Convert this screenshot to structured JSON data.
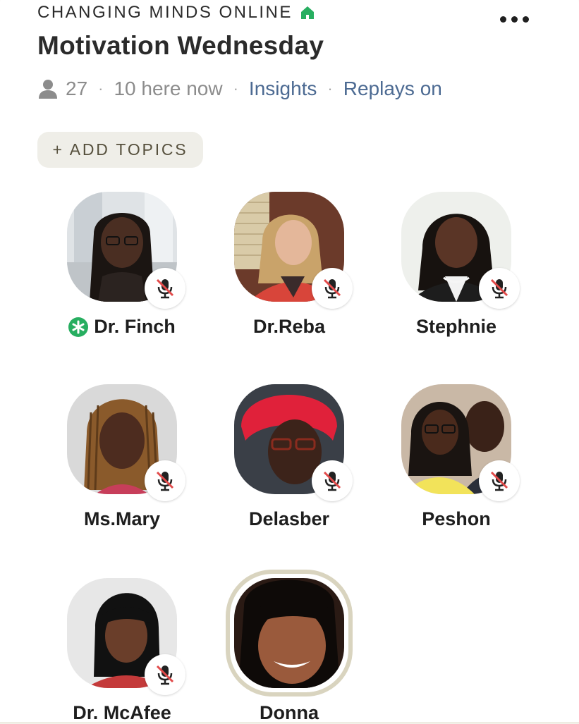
{
  "header": {
    "club_name": "CHANGING MINDS ONLINE",
    "club_icon": "house-icon",
    "more_icon": "ellipsis-icon",
    "room_title": "Motivation Wednesday",
    "listener_icon": "person-icon",
    "listener_count": "27",
    "here_now": "10 here now",
    "insights_label": "Insights",
    "replays_label": "Replays on",
    "separator": "·"
  },
  "topics": {
    "add_label": "+ ADD TOPICS"
  },
  "speakers": [
    {
      "name": "Dr. Finch",
      "moderator": true,
      "muted": true,
      "speaking": false
    },
    {
      "name": "Dr.Reba",
      "moderator": false,
      "muted": true,
      "speaking": false
    },
    {
      "name": "Stephnie",
      "moderator": false,
      "muted": true,
      "speaking": false
    },
    {
      "name": "Ms.Mary",
      "moderator": false,
      "muted": true,
      "speaking": false
    },
    {
      "name": "Delasber",
      "moderator": false,
      "muted": true,
      "speaking": false
    },
    {
      "name": "Peshon",
      "moderator": false,
      "muted": true,
      "speaking": false
    },
    {
      "name": "Dr. McAfee",
      "moderator": false,
      "muted": true,
      "speaking": false
    },
    {
      "name": "Donna",
      "moderator": false,
      "muted": false,
      "speaking": true
    }
  ],
  "colors": {
    "link": "#4c6a92",
    "moderator_green": "#27ae60",
    "club_house_green": "#27ae60",
    "speaking_ring": "#d9d4bf",
    "mute_red": "#e24a4a"
  }
}
